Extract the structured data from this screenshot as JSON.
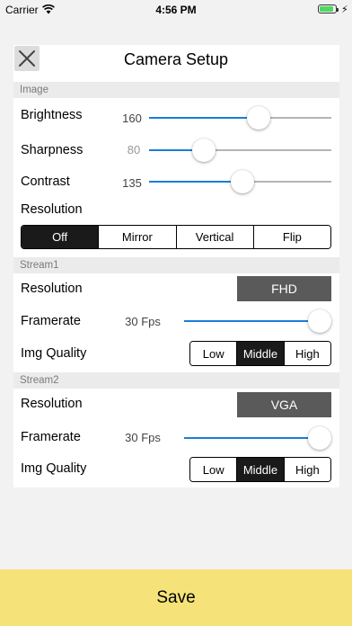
{
  "status": {
    "carrier": "Carrier",
    "time": "4:56 PM",
    "battery_level": 0.9
  },
  "header": {
    "title": "Camera Setup",
    "close_icon": "close-icon"
  },
  "image": {
    "section_label": "Image",
    "brightness": {
      "label": "Brightness",
      "value": "160",
      "fraction": 0.6
    },
    "sharpness": {
      "label": "Sharpness",
      "value": "80",
      "fraction": 0.3
    },
    "contrast": {
      "label": "Contrast",
      "value": "135",
      "fraction": 0.51
    },
    "resolution": {
      "label": "Resolution",
      "options": [
        "Off",
        "Mirror",
        "Vertical",
        "Flip"
      ],
      "selected": 0
    }
  },
  "stream1": {
    "section_label": "Stream1",
    "resolution": {
      "label": "Resolution",
      "value": "FHD"
    },
    "framerate": {
      "label": "Framerate",
      "value": "30 Fps",
      "fraction": 1.0
    },
    "img_quality": {
      "label": "Img Quality",
      "options": [
        "Low",
        "Middle",
        "High"
      ],
      "selected": 1
    }
  },
  "stream2": {
    "section_label": "Stream2",
    "resolution": {
      "label": "Resolution",
      "value": "VGA"
    },
    "framerate": {
      "label": "Framerate",
      "value": "30 Fps",
      "fraction": 1.0
    },
    "img_quality": {
      "label": "Img Quality",
      "options": [
        "Low",
        "Middle",
        "High"
      ],
      "selected": 1
    }
  },
  "footer": {
    "save_label": "Save"
  },
  "colors": {
    "accent": "#1a7dd9",
    "save_bg": "#f5e37a",
    "selected_segment": "#1a1a1a",
    "resolution_button": "#5a5a5a"
  }
}
